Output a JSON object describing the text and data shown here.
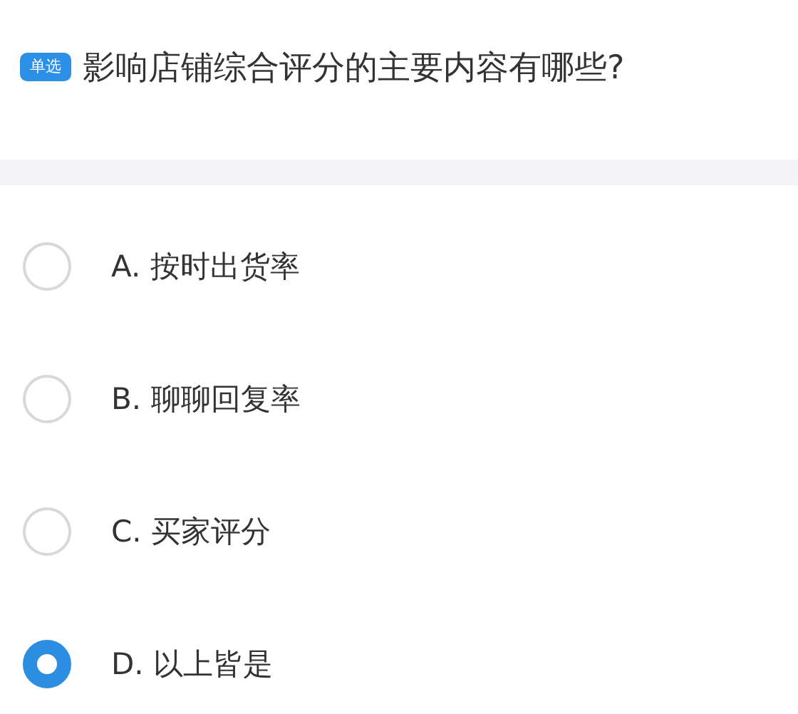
{
  "question": {
    "badge": "单选",
    "text": "影响店铺综合评分的主要内容有哪些?"
  },
  "options": [
    {
      "label": "A. 按时出货率",
      "selected": false
    },
    {
      "label": "B. 聊聊回复率",
      "selected": false
    },
    {
      "label": "C. 买家评分",
      "selected": false
    },
    {
      "label": "D. 以上皆是",
      "selected": true
    }
  ]
}
